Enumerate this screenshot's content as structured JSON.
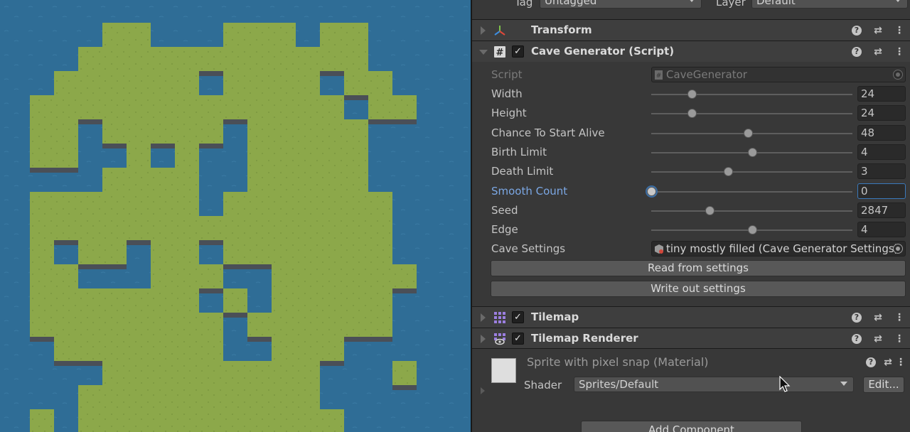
{
  "inspector": {
    "tag_label": "Tag",
    "tag_value": "Untagged",
    "layer_label": "Layer",
    "layer_value": "Default",
    "components": {
      "transform": {
        "title": "Transform"
      },
      "cave_generator": {
        "title": "Cave Generator (Script)",
        "enabled": true,
        "script_label": "Script",
        "script_value": "CaveGenerator",
        "properties": [
          {
            "label": "Width",
            "value": "24",
            "fraction": 0.2
          },
          {
            "label": "Height",
            "value": "24",
            "fraction": 0.2
          },
          {
            "label": "Chance To Start Alive",
            "value": "48",
            "fraction": 0.48
          },
          {
            "label": "Birth Limit",
            "value": "4",
            "fraction": 0.5
          },
          {
            "label": "Death Limit",
            "value": "3",
            "fraction": 0.38
          },
          {
            "label": "Smooth Count",
            "value": "0",
            "fraction": 0.0
          },
          {
            "label": "Seed",
            "value": "2847",
            "fraction": 0.29
          },
          {
            "label": "Edge",
            "value": "4",
            "fraction": 0.5
          }
        ],
        "cave_settings_label": "Cave Settings",
        "cave_settings_value": "tiny mostly filled (Cave Generator Settings)",
        "read_button": "Read from settings",
        "write_button": "Write out settings"
      },
      "tilemap": {
        "title": "Tilemap",
        "enabled": true
      },
      "tilemap_renderer": {
        "title": "Tilemap Renderer",
        "enabled": true
      }
    },
    "material": {
      "title": "Sprite with pixel snap (Material)",
      "shader_label": "Shader",
      "shader_value": "Sprites/Default",
      "edit_button": "Edit..."
    },
    "add_component": "Add Component"
  },
  "colors": {
    "water": "#2f6d96",
    "grass": "#8ca84a",
    "cliff": "#4a4f57",
    "inspector_bg": "#383838",
    "focus_blue": "#7ba7e4"
  }
}
